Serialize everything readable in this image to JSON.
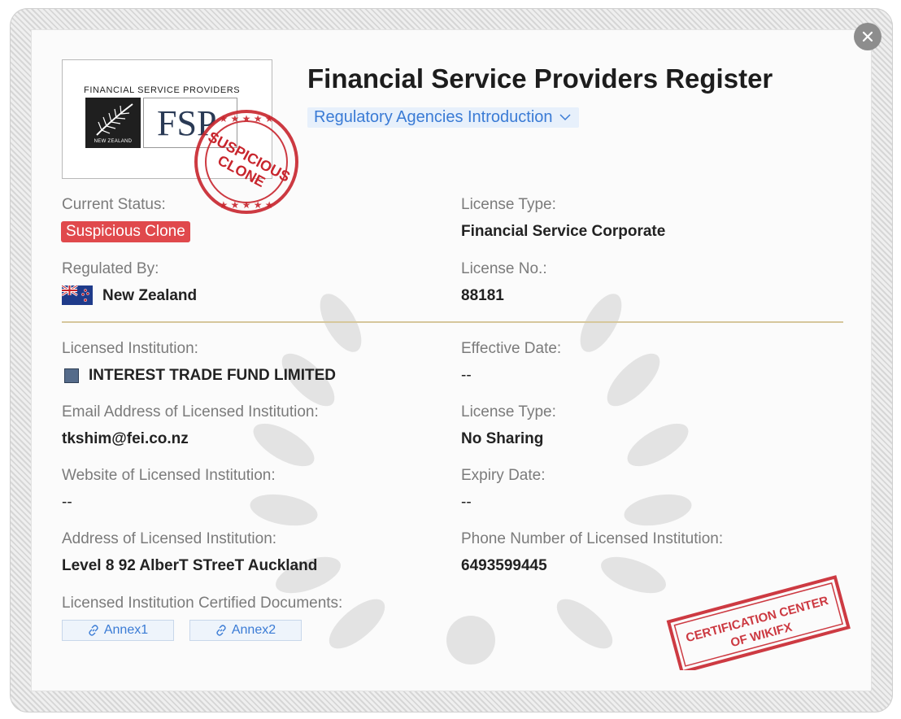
{
  "header": {
    "title": "Financial Service Providers Register",
    "agency_dropdown": "Regulatory Agencies Introduction"
  },
  "logo": {
    "caption": "FINANCIAL SERVICE PROVIDERS",
    "country_text": "NEW ZEALAND",
    "mark_text": "FSP"
  },
  "stamps": {
    "clone_line1": "SUSPICIOUS",
    "clone_line2": "CLONE",
    "cert_line1": "CERTIFICATION CENTER",
    "cert_line2": "OF WIKIFX"
  },
  "fields": {
    "current_status": {
      "label": "Current Status:",
      "value": "Suspicious Clone"
    },
    "license_type_1": {
      "label": "License Type:",
      "value": "Financial Service Corporate"
    },
    "regulated_by": {
      "label": "Regulated By:",
      "value": "New Zealand"
    },
    "license_no": {
      "label": "License No.:",
      "value": "88181"
    },
    "licensed_institution": {
      "label": "Licensed Institution:",
      "value": "INTEREST TRADE FUND LIMITED"
    },
    "effective_date": {
      "label": "Effective Date:",
      "value": "--"
    },
    "email": {
      "label": "Email Address of Licensed Institution:",
      "value": "tkshim@fei.co.nz"
    },
    "license_type_2": {
      "label": "License Type:",
      "value": "No Sharing"
    },
    "website": {
      "label": "Website of Licensed Institution:",
      "value": "--"
    },
    "expiry_date": {
      "label": "Expiry Date:",
      "value": "--"
    },
    "address": {
      "label": "Address of Licensed Institution:",
      "value": "Level 8 92 AlberT STreeT Auckland"
    },
    "phone": {
      "label": "Phone Number of Licensed Institution:",
      "value": "6493599445"
    },
    "documents": {
      "label": "Licensed Institution Certified Documents:"
    }
  },
  "annexes": [
    "Annex1",
    "Annex2"
  ],
  "icons": {
    "close": "close-icon",
    "dropdown": "chevron-down-icon",
    "flag": "new-zealand-flag-icon",
    "institution": "institution-logo-icon",
    "link": "link-icon"
  },
  "colors": {
    "status_badge": "#e0494c",
    "link": "#3a7bd5",
    "divider": "#d6c79c",
    "stamp_red": "#c8252d"
  }
}
